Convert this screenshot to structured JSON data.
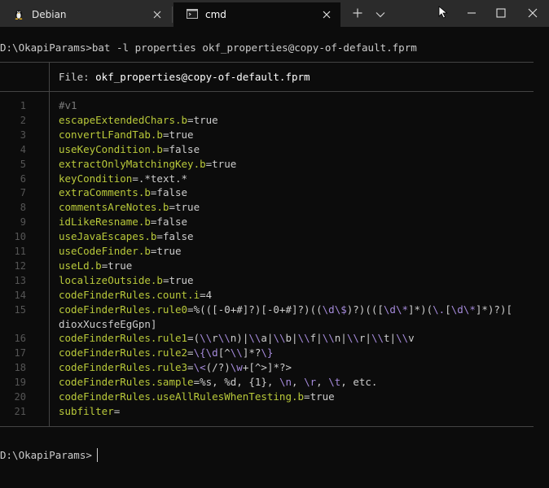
{
  "titlebar": {
    "tabs": [
      {
        "label": "Debian",
        "icon": "linux-penguin-icon"
      },
      {
        "label": "cmd",
        "icon": "cmd-icon"
      }
    ]
  },
  "terminal": {
    "command_line": "D:\\OkapiParams>bat -l properties okf_properties@copy-of-default.fprm",
    "file_header_label": "File: ",
    "file_name": "okf_properties@copy-of-default.fprm",
    "lines": [
      {
        "n": "1",
        "key": "#v1",
        "value": ""
      },
      {
        "n": "2",
        "key": "escapeExtendedChars.b",
        "value": "true"
      },
      {
        "n": "3",
        "key": "convertLFandTab.b",
        "value": "true"
      },
      {
        "n": "4",
        "key": "useKeyCondition.b",
        "value": "false"
      },
      {
        "n": "5",
        "key": "extractOnlyMatchingKey.b",
        "value": "true"
      },
      {
        "n": "6",
        "key": "keyCondition",
        "value": ".*text.*"
      },
      {
        "n": "7",
        "key": "extraComments.b",
        "value": "false"
      },
      {
        "n": "8",
        "key": "commentsAreNotes.b",
        "value": "true"
      },
      {
        "n": "9",
        "key": "idLikeResname.b",
        "value": "false"
      },
      {
        "n": "10",
        "key": "useJavaEscapes.b",
        "value": "false"
      },
      {
        "n": "11",
        "key": "useCodeFinder.b",
        "value": "true"
      },
      {
        "n": "12",
        "key": "useLd.b",
        "value": "true"
      },
      {
        "n": "13",
        "key": "localizeOutside.b",
        "value": "true"
      },
      {
        "n": "14",
        "key": "codeFinderRules.count.i",
        "value": "4"
      },
      {
        "n": "15",
        "key": "codeFinderRules.rule0",
        "value": "%(([-0+#]?)[-0+#]?)((\\d\\$)?)(([\\d\\*]*)(\\.[\\d\\*]*)?)[",
        "value_wrap": "dioxXucsfeEgGpn]"
      },
      {
        "n": "16",
        "key": "codeFinderRules.rule1",
        "value": "(\\\\r\\\\n)|\\\\a|\\\\b|\\\\f|\\\\n|\\\\r|\\\\t|\\\\v"
      },
      {
        "n": "17",
        "key": "codeFinderRules.rule2",
        "value": "\\{\\d[^\\\\]*?\\}"
      },
      {
        "n": "18",
        "key": "codeFinderRules.rule3",
        "value": "\\<(/?)\\w+[^>]*?>"
      },
      {
        "n": "19",
        "key": "codeFinderRules.sample",
        "value": "%s, %d, {1}, \\n, \\r, \\t, etc."
      },
      {
        "n": "20",
        "key": "codeFinderRules.useAllRulesWhenTesting.b",
        "value": "true"
      },
      {
        "n": "21",
        "key": "subfilter",
        "value": ""
      }
    ],
    "prompt": "D:\\OkapiParams>"
  },
  "colors": {
    "background": "#0c0c0c",
    "key": "#b9c93a",
    "value": "#cccccc",
    "escape": "#a68bdc",
    "line_number": "#555555"
  }
}
